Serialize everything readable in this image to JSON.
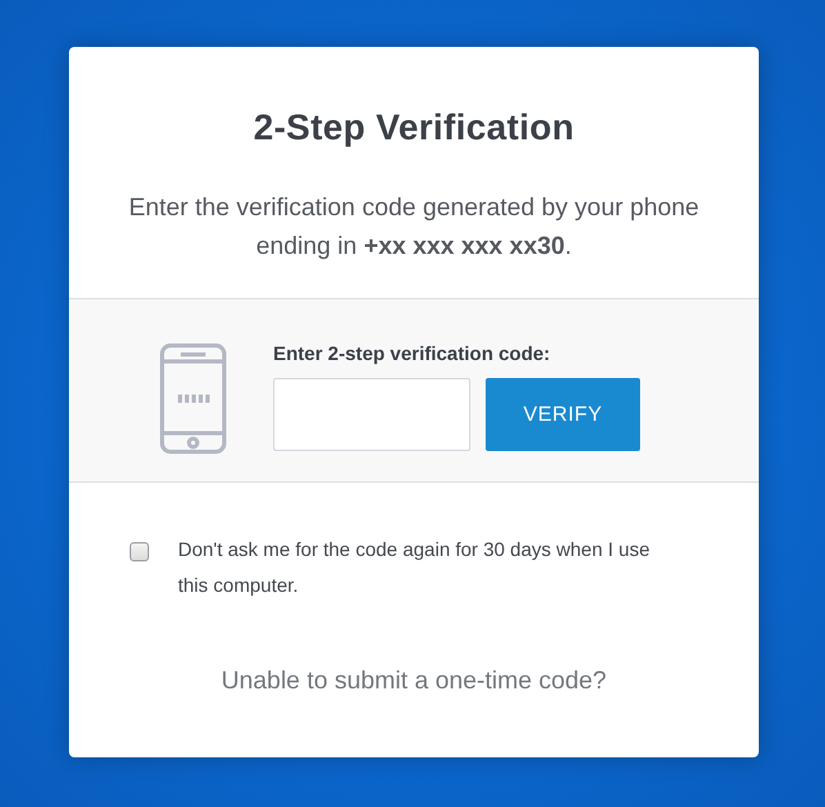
{
  "dialog": {
    "title": "2-Step Verification",
    "message": "Enter the verification code generated by your phone ending in **+xx xxx xxx xx30**.",
    "code_label": "Enter 2-step verification code:",
    "verify_button": "VERIFY",
    "remember": {
      "label": "Don't ask me for the code again for 30 days when I use this computer.",
      "checked": false
    },
    "help_link": "Unable to submit a one-time code?"
  }
}
